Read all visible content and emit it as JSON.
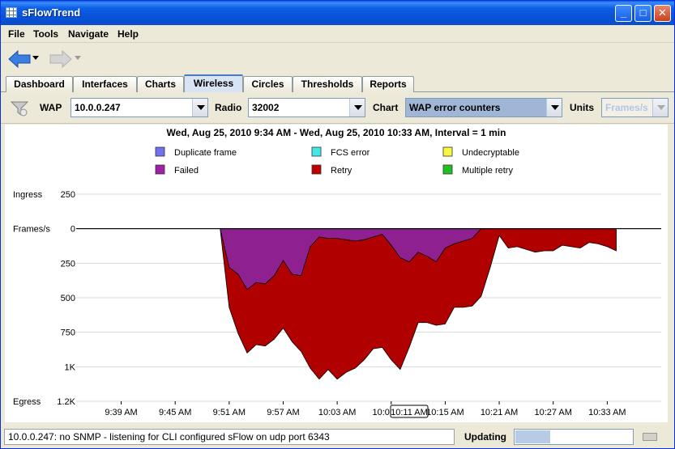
{
  "window": {
    "title": "sFlowTrend"
  },
  "menu": {
    "items": [
      "File",
      "Tools",
      "Navigate",
      "Help"
    ]
  },
  "tabs": [
    {
      "label": "Dashboard",
      "active": false
    },
    {
      "label": "Interfaces",
      "active": false
    },
    {
      "label": "Charts",
      "active": false
    },
    {
      "label": "Wireless",
      "active": true
    },
    {
      "label": "Circles",
      "active": false
    },
    {
      "label": "Thresholds",
      "active": false
    },
    {
      "label": "Reports",
      "active": false
    }
  ],
  "selectors": {
    "wap": {
      "label": "WAP",
      "value": "10.0.0.247"
    },
    "radio": {
      "label": "Radio",
      "value": "32002"
    },
    "chart": {
      "label": "Chart",
      "value": "WAP error counters"
    },
    "units": {
      "label": "Units",
      "value": "Frames/s"
    }
  },
  "status": {
    "message": "10.0.0.247: no SNMP - listening for CLI configured sFlow on udp port 6343",
    "updating_label": "Updating",
    "progress": 0.3
  },
  "colors": {
    "duplicate_frame": "#7070f0",
    "fcs_error": "#40e8e8",
    "undecryptable": "#f8f840",
    "failed": "#8e2090",
    "retry": "#b00000",
    "multiple_retry": "#20c020"
  },
  "chart_data": {
    "type": "area",
    "title": "Wed, Aug 25, 2010 9:34 AM - Wed, Aug 25, 2010 10:33 AM, Interval = 1 min",
    "legend": [
      {
        "name": "Duplicate frame",
        "color": "#7070f0"
      },
      {
        "name": "FCS error",
        "color": "#40e8e8"
      },
      {
        "name": "Undecryptable",
        "color": "#f8f840"
      },
      {
        "name": "Failed",
        "color": "#a020a8"
      },
      {
        "name": "Retry",
        "color": "#c00000"
      },
      {
        "name": "Multiple retry",
        "color": "#20c020"
      }
    ],
    "legend_placement": "top",
    "y_top_label": "Ingress",
    "y_zero_label": "Frames/s",
    "y_bottom_label": "Egress",
    "y_ticks": [
      {
        "value": 250,
        "label": "250"
      },
      {
        "value": 0,
        "label": "0"
      },
      {
        "value": -250,
        "label": "250"
      },
      {
        "value": -500,
        "label": "500"
      },
      {
        "value": -750,
        "label": "750"
      },
      {
        "value": -1000,
        "label": "1K"
      },
      {
        "value": -1250,
        "label": "1.2K"
      }
    ],
    "ylim": [
      -1250,
      250
    ],
    "x_ticks": [
      "9:39 AM",
      "9:45 AM",
      "9:51 AM",
      "9:57 AM",
      "10:03 AM",
      "10:09 AM",
      "10:15 AM",
      "10:21 AM",
      "10:27 AM",
      "10:33 AM"
    ],
    "x_tick_minutes": [
      5,
      11,
      17,
      23,
      29,
      35,
      41,
      47,
      53,
      59
    ],
    "cursor_label": "10:11 AM",
    "cursor_minute": 37,
    "xlim_minutes": [
      0,
      65
    ],
    "x_start_label": "9:34 AM",
    "series": [
      {
        "name": "Failed",
        "minutes": [
          16,
          17,
          18,
          19,
          20,
          21,
          22,
          23,
          24,
          25,
          26,
          27,
          28,
          29,
          30,
          31,
          32,
          33,
          34,
          35,
          36,
          37,
          38,
          39,
          40,
          41,
          42,
          43,
          44,
          45,
          46
        ],
        "values": [
          0,
          -280,
          -330,
          -440,
          -390,
          -400,
          -340,
          -230,
          -330,
          -340,
          -130,
          -60,
          -70,
          -70,
          -80,
          -90,
          -80,
          -60,
          -40,
          -120,
          -210,
          -240,
          -170,
          -200,
          -240,
          -140,
          -110,
          -90,
          -70,
          0,
          0
        ]
      },
      {
        "name": "Retry",
        "minutes": [
          16,
          17,
          18,
          19,
          20,
          21,
          22,
          23,
          24,
          25,
          26,
          27,
          28,
          29,
          30,
          31,
          32,
          33,
          34,
          35,
          36,
          37,
          38,
          39,
          40,
          41,
          42,
          43,
          44,
          45,
          46,
          47,
          48,
          49,
          50,
          51,
          52,
          53,
          54,
          55,
          56,
          57,
          58,
          59,
          60
        ],
        "values": [
          0,
          -570,
          -760,
          -900,
          -840,
          -850,
          -800,
          -720,
          -820,
          -890,
          -1010,
          -1090,
          -1020,
          -1090,
          -1040,
          -1010,
          -950,
          -870,
          -860,
          -950,
          -1020,
          -860,
          -680,
          -680,
          -700,
          -690,
          -570,
          -570,
          -560,
          -490,
          -280,
          -50,
          -140,
          -130,
          -150,
          -170,
          -160,
          -160,
          -120,
          -130,
          -140,
          -100,
          -110,
          -130,
          -160
        ]
      }
    ]
  }
}
